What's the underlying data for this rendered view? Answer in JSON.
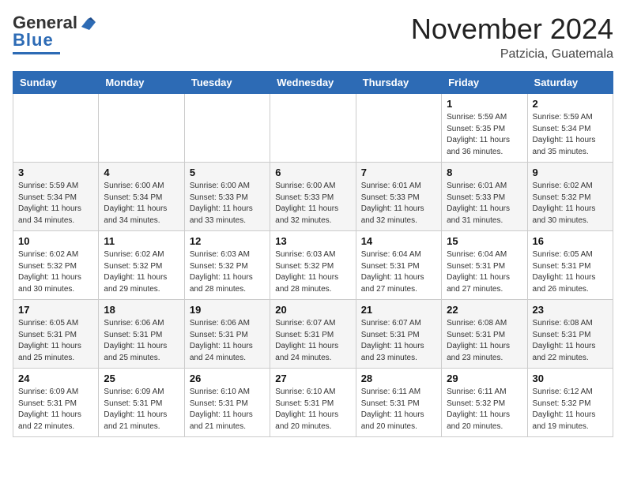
{
  "header": {
    "logo_general": "General",
    "logo_blue": "Blue",
    "month_title": "November 2024",
    "location": "Patzicia, Guatemala"
  },
  "days_of_week": [
    "Sunday",
    "Monday",
    "Tuesday",
    "Wednesday",
    "Thursday",
    "Friday",
    "Saturday"
  ],
  "weeks": [
    [
      {
        "day": "",
        "info": ""
      },
      {
        "day": "",
        "info": ""
      },
      {
        "day": "",
        "info": ""
      },
      {
        "day": "",
        "info": ""
      },
      {
        "day": "",
        "info": ""
      },
      {
        "day": "1",
        "info": "Sunrise: 5:59 AM\nSunset: 5:35 PM\nDaylight: 11 hours\nand 36 minutes."
      },
      {
        "day": "2",
        "info": "Sunrise: 5:59 AM\nSunset: 5:34 PM\nDaylight: 11 hours\nand 35 minutes."
      }
    ],
    [
      {
        "day": "3",
        "info": "Sunrise: 5:59 AM\nSunset: 5:34 PM\nDaylight: 11 hours\nand 34 minutes."
      },
      {
        "day": "4",
        "info": "Sunrise: 6:00 AM\nSunset: 5:34 PM\nDaylight: 11 hours\nand 34 minutes."
      },
      {
        "day": "5",
        "info": "Sunrise: 6:00 AM\nSunset: 5:33 PM\nDaylight: 11 hours\nand 33 minutes."
      },
      {
        "day": "6",
        "info": "Sunrise: 6:00 AM\nSunset: 5:33 PM\nDaylight: 11 hours\nand 32 minutes."
      },
      {
        "day": "7",
        "info": "Sunrise: 6:01 AM\nSunset: 5:33 PM\nDaylight: 11 hours\nand 32 minutes."
      },
      {
        "day": "8",
        "info": "Sunrise: 6:01 AM\nSunset: 5:33 PM\nDaylight: 11 hours\nand 31 minutes."
      },
      {
        "day": "9",
        "info": "Sunrise: 6:02 AM\nSunset: 5:32 PM\nDaylight: 11 hours\nand 30 minutes."
      }
    ],
    [
      {
        "day": "10",
        "info": "Sunrise: 6:02 AM\nSunset: 5:32 PM\nDaylight: 11 hours\nand 30 minutes."
      },
      {
        "day": "11",
        "info": "Sunrise: 6:02 AM\nSunset: 5:32 PM\nDaylight: 11 hours\nand 29 minutes."
      },
      {
        "day": "12",
        "info": "Sunrise: 6:03 AM\nSunset: 5:32 PM\nDaylight: 11 hours\nand 28 minutes."
      },
      {
        "day": "13",
        "info": "Sunrise: 6:03 AM\nSunset: 5:32 PM\nDaylight: 11 hours\nand 28 minutes."
      },
      {
        "day": "14",
        "info": "Sunrise: 6:04 AM\nSunset: 5:31 PM\nDaylight: 11 hours\nand 27 minutes."
      },
      {
        "day": "15",
        "info": "Sunrise: 6:04 AM\nSunset: 5:31 PM\nDaylight: 11 hours\nand 27 minutes."
      },
      {
        "day": "16",
        "info": "Sunrise: 6:05 AM\nSunset: 5:31 PM\nDaylight: 11 hours\nand 26 minutes."
      }
    ],
    [
      {
        "day": "17",
        "info": "Sunrise: 6:05 AM\nSunset: 5:31 PM\nDaylight: 11 hours\nand 25 minutes."
      },
      {
        "day": "18",
        "info": "Sunrise: 6:06 AM\nSunset: 5:31 PM\nDaylight: 11 hours\nand 25 minutes."
      },
      {
        "day": "19",
        "info": "Sunrise: 6:06 AM\nSunset: 5:31 PM\nDaylight: 11 hours\nand 24 minutes."
      },
      {
        "day": "20",
        "info": "Sunrise: 6:07 AM\nSunset: 5:31 PM\nDaylight: 11 hours\nand 24 minutes."
      },
      {
        "day": "21",
        "info": "Sunrise: 6:07 AM\nSunset: 5:31 PM\nDaylight: 11 hours\nand 23 minutes."
      },
      {
        "day": "22",
        "info": "Sunrise: 6:08 AM\nSunset: 5:31 PM\nDaylight: 11 hours\nand 23 minutes."
      },
      {
        "day": "23",
        "info": "Sunrise: 6:08 AM\nSunset: 5:31 PM\nDaylight: 11 hours\nand 22 minutes."
      }
    ],
    [
      {
        "day": "24",
        "info": "Sunrise: 6:09 AM\nSunset: 5:31 PM\nDaylight: 11 hours\nand 22 minutes."
      },
      {
        "day": "25",
        "info": "Sunrise: 6:09 AM\nSunset: 5:31 PM\nDaylight: 11 hours\nand 21 minutes."
      },
      {
        "day": "26",
        "info": "Sunrise: 6:10 AM\nSunset: 5:31 PM\nDaylight: 11 hours\nand 21 minutes."
      },
      {
        "day": "27",
        "info": "Sunrise: 6:10 AM\nSunset: 5:31 PM\nDaylight: 11 hours\nand 20 minutes."
      },
      {
        "day": "28",
        "info": "Sunrise: 6:11 AM\nSunset: 5:31 PM\nDaylight: 11 hours\nand 20 minutes."
      },
      {
        "day": "29",
        "info": "Sunrise: 6:11 AM\nSunset: 5:32 PM\nDaylight: 11 hours\nand 20 minutes."
      },
      {
        "day": "30",
        "info": "Sunrise: 6:12 AM\nSunset: 5:32 PM\nDaylight: 11 hours\nand 19 minutes."
      }
    ]
  ]
}
